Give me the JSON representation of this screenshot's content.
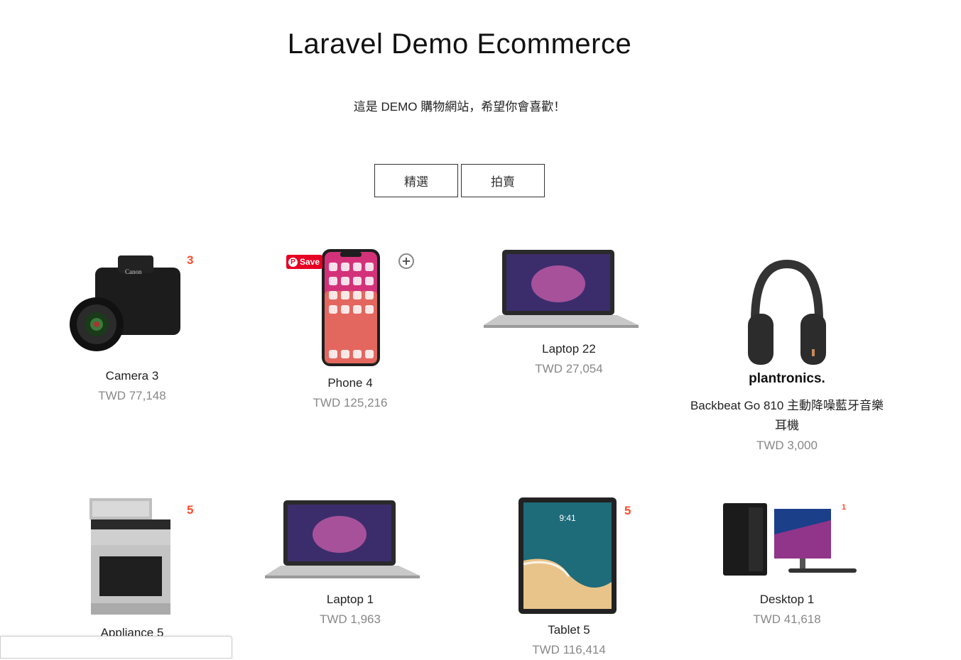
{
  "header": {
    "title": "Laravel Demo Ecommerce",
    "subtitle": "這是 DEMO 購物網站，希望你會喜歡！"
  },
  "filters": [
    "精選",
    "拍賣"
  ],
  "pinterest": {
    "save_label": "Save"
  },
  "products": [
    {
      "name": "Camera 3",
      "price": "TWD 77,148",
      "badge": "3"
    },
    {
      "name": "Phone 4",
      "price": "TWD 125,216",
      "badge": ""
    },
    {
      "name": "Laptop 22",
      "price": "TWD 27,054",
      "badge": ""
    },
    {
      "name": "Backbeat Go 810 主動降噪藍牙音樂耳機",
      "price": "TWD 3,000",
      "badge": "",
      "brand": "plantronics."
    },
    {
      "name": "Appliance 5",
      "price": "",
      "badge": "5"
    },
    {
      "name": "Laptop 1",
      "price": "TWD 1,963",
      "badge": ""
    },
    {
      "name": "Tablet 5",
      "price": "TWD 116,414",
      "badge": "5"
    },
    {
      "name": "Desktop 1",
      "price": "TWD 41,618",
      "badge": "1"
    }
  ],
  "colors": {
    "badge": "#ff4b2b",
    "price": "#888888",
    "pinterest": "#e60023"
  }
}
